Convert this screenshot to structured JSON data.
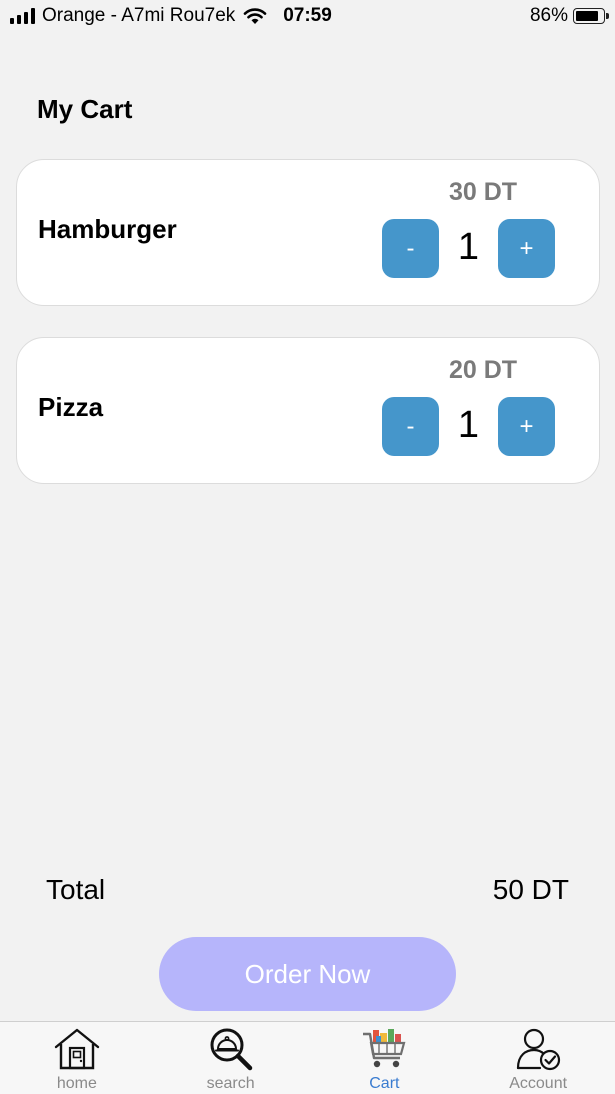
{
  "status_bar": {
    "carrier": "Orange - A7mi Rou7ek",
    "time": "07:59",
    "battery_percent": "86%",
    "battery_level": 0.86
  },
  "page": {
    "title": "My Cart"
  },
  "cart": {
    "items": [
      {
        "name": "Hamburger",
        "price": "30 DT",
        "quantity": "1",
        "minus_label": "-",
        "plus_label": "+"
      },
      {
        "name": "Pizza",
        "price": "20 DT",
        "quantity": "1",
        "minus_label": "-",
        "plus_label": "+"
      }
    ]
  },
  "summary": {
    "total_label": "Total",
    "total_value": "50 DT"
  },
  "actions": {
    "order_label": "Order Now"
  },
  "tabs": [
    {
      "label": "home",
      "icon": "home-icon",
      "active": false
    },
    {
      "label": "search",
      "icon": "search-icon",
      "active": false
    },
    {
      "label": "Cart",
      "icon": "cart-icon",
      "active": true
    },
    {
      "label": "Account",
      "icon": "account-icon",
      "active": false
    }
  ],
  "colors": {
    "qty_button": "#4596cb",
    "order_button": "#b6b5fb",
    "active_tab": "#3a7cd0",
    "price_text": "#7a7a7a",
    "background": "#f2f2f2"
  }
}
